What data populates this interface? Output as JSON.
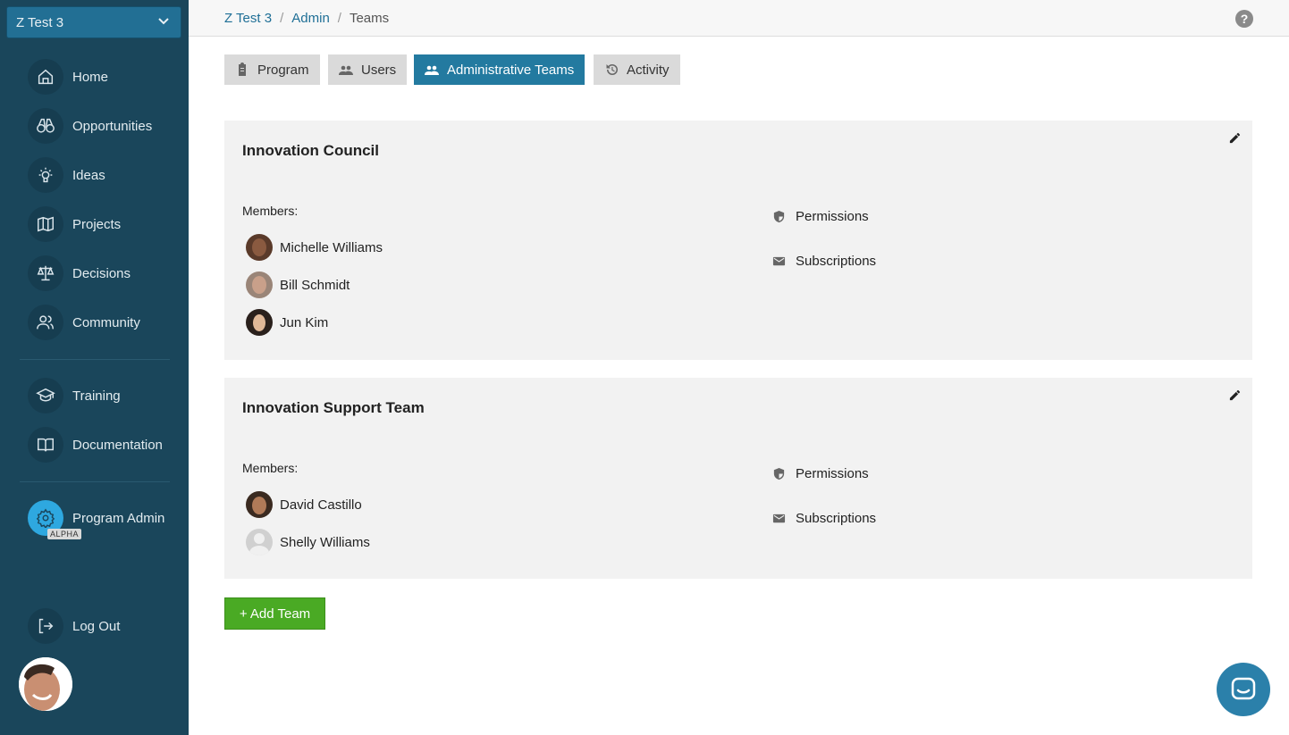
{
  "sidebar": {
    "program_selector": "Z Test 3",
    "items": [
      {
        "label": "Home",
        "icon": "home-icon"
      },
      {
        "label": "Opportunities",
        "icon": "binoculars-icon"
      },
      {
        "label": "Ideas",
        "icon": "lightbulb-icon"
      },
      {
        "label": "Projects",
        "icon": "map-icon"
      },
      {
        "label": "Decisions",
        "icon": "scale-icon"
      },
      {
        "label": "Community",
        "icon": "people-icon"
      },
      {
        "label": "Training",
        "icon": "graduation-cap-icon"
      },
      {
        "label": "Documentation",
        "icon": "book-icon"
      },
      {
        "label": "Program Admin",
        "icon": "gear-icon",
        "badge": "ALPHA"
      },
      {
        "label": "Log Out",
        "icon": "logout-icon"
      }
    ]
  },
  "breadcrumb": [
    "Z Test 3",
    "Admin",
    "Teams"
  ],
  "tabs": [
    {
      "label": "Program",
      "icon": "clipboard-icon"
    },
    {
      "label": "Users",
      "icon": "users-icon"
    },
    {
      "label": "Administrative Teams",
      "icon": "users-icon",
      "active": true
    },
    {
      "label": "Activity",
      "icon": "history-icon"
    }
  ],
  "teams": [
    {
      "name": "Innovation Council",
      "members_label": "Members:",
      "members": [
        "Michelle Williams",
        "Bill Schmidt",
        "Jun Kim"
      ],
      "permissions": "Permissions",
      "subscriptions": "Subscriptions"
    },
    {
      "name": "Innovation Support Team",
      "members_label": "Members:",
      "members": [
        "David Castillo",
        "Shelly Williams"
      ],
      "permissions": "Permissions",
      "subscriptions": "Subscriptions"
    }
  ],
  "add_team_label": "+ Add Team",
  "colors": {
    "sidebar": "#1a465b",
    "accent": "#237aa0",
    "add": "#4aaa24"
  }
}
